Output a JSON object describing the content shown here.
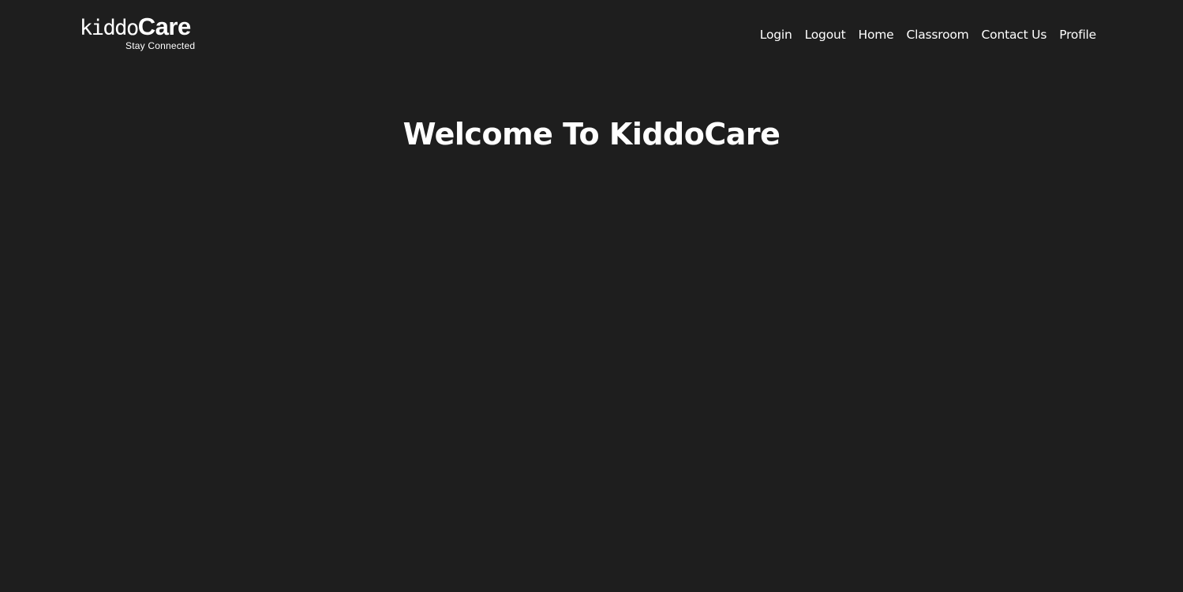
{
  "brand": {
    "name_part1": "kiddo",
    "name_part2": "Care",
    "tagline": "Stay Connected"
  },
  "nav": {
    "items": [
      {
        "label": "Login"
      },
      {
        "label": "Logout"
      },
      {
        "label": "Home"
      },
      {
        "label": "Classroom"
      },
      {
        "label": "Contact Us"
      },
      {
        "label": "Profile"
      }
    ]
  },
  "hero": {
    "title": "Welcome To KiddoCare"
  },
  "colors": {
    "background": "#1e1e1e",
    "text": "#ffffff"
  }
}
